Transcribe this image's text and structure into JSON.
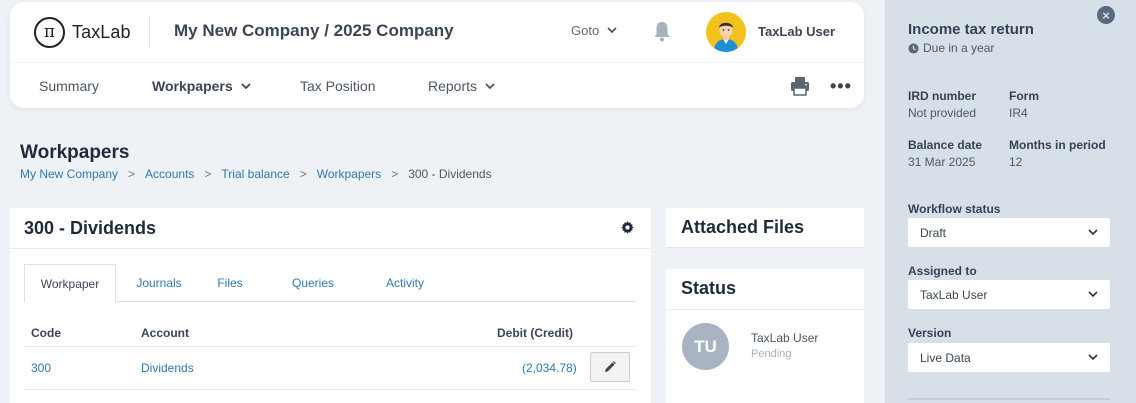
{
  "header": {
    "logo_glyph": "π",
    "logo_text": "TaxLab",
    "company_title": "My New Company / 2025 Company",
    "goto_label": "Goto",
    "user_name": "TaxLab User"
  },
  "nav": {
    "summary": "Summary",
    "workpapers": "Workpapers",
    "tax_position": "Tax Position",
    "reports": "Reports"
  },
  "page": {
    "title": "Workpapers",
    "breadcrumb": [
      "My New Company",
      "Accounts",
      "Trial balance",
      "Workpapers",
      "300 - Dividends"
    ],
    "breadcrumb_separator": ">"
  },
  "workpaper": {
    "title": "300 - Dividends",
    "tabs": [
      "Workpaper",
      "Journals",
      "Files",
      "Queries",
      "Activity"
    ],
    "active_tab": "Workpaper",
    "columns": [
      "Code",
      "Account",
      "Debit (Credit)"
    ],
    "rows": [
      {
        "code": "300",
        "account": "Dividends",
        "amount": "(2,034.78)"
      }
    ]
  },
  "attached_files": {
    "title": "Attached Files"
  },
  "status": {
    "title": "Status",
    "initials": "TU",
    "user": "TaxLab User",
    "state": "Pending"
  },
  "panel": {
    "title": "Income tax return",
    "due": "Due in a year",
    "close_glyph": "×",
    "ird_label": "IRD number",
    "ird_value": "Not provided",
    "form_label": "Form",
    "form_value": "IR4",
    "balance_date_label": "Balance date",
    "balance_date_value": "31 Mar 2025",
    "months_label": "Months in period",
    "months_value": "12",
    "workflow_label": "Workflow status",
    "workflow_value": "Draft",
    "assigned_label": "Assigned to",
    "assigned_value": "TaxLab User",
    "version_label": "Version",
    "version_value": "Live Data"
  },
  "colors": {
    "link": "#2e78b7",
    "panel_bg": "#d7dfe9",
    "page_bg": "#eef1f6",
    "avatar_bg": "#f3c21a"
  },
  "icons": [
    "bell-icon",
    "printer-icon",
    "more-icon",
    "gear-icon",
    "pencil-icon",
    "clock-icon",
    "close-icon",
    "chevron-down-icon"
  ]
}
